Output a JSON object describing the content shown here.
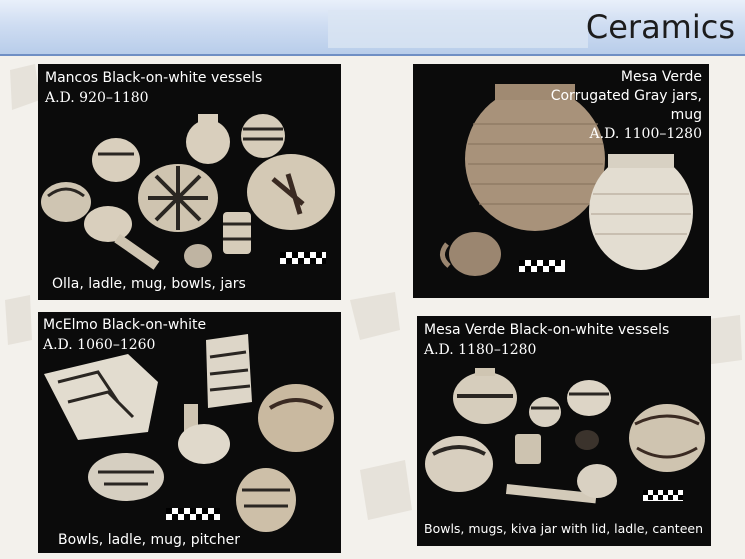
{
  "slide": {
    "title": "Ceramics"
  },
  "panels": [
    {
      "heading": "Mancos Black-on-white vessels",
      "dates": "A.D. 920–1180",
      "caption": "Olla, ladle, mug, bowls, jars"
    },
    {
      "heading_lines": [
        "Mesa Verde",
        "Corrugated Gray jars,",
        "mug"
      ],
      "dates": "A.D. 1100–1280"
    },
    {
      "heading": "McElmo Black-on-white",
      "dates": "A.D. 1060–1260",
      "caption": "Bowls, ladle, mug, pitcher"
    },
    {
      "heading": "Mesa Verde Black-on-white vessels",
      "dates": "A.D. 1180–1280",
      "caption": "Bowls, mugs, kiva jar with lid, ladle, canteen"
    }
  ],
  "colors": {
    "header_blue": "#b8cdea",
    "panel_black": "#0b0b0b",
    "pottery_cream": "#d9cfbd",
    "pottery_paint": "#2a2622",
    "corrugated_tan": "#a8927a"
  }
}
